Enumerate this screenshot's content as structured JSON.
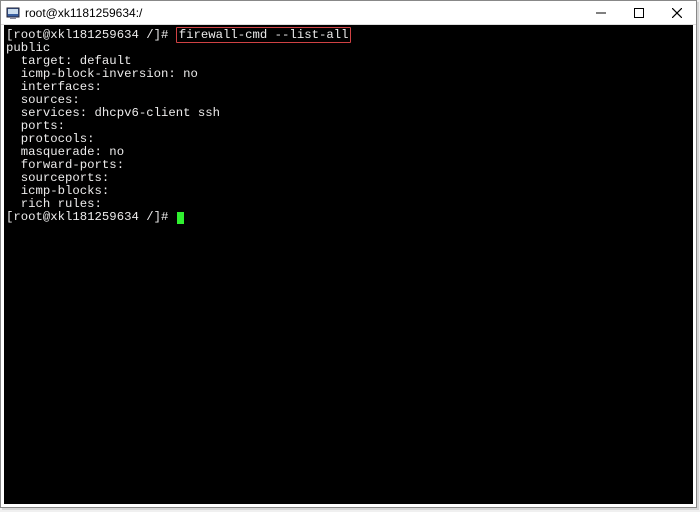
{
  "titlebar": {
    "title": "root@xk1181259634:/"
  },
  "terminal": {
    "prompt1_user": "[root@xkl181259634 /]#",
    "command1": "firewall-cmd --list-all",
    "output": {
      "l0": "public",
      "l1": "  target: default",
      "l2": "  icmp-block-inversion: no",
      "l3": "  interfaces:",
      "l4": "  sources:",
      "l5": "  services: dhcpv6-client ssh",
      "l6": "  ports:",
      "l7": "  protocols:",
      "l8": "  masquerade: no",
      "l9": "  forward-ports:",
      "l10": "  sourceports:",
      "l11": "  icmp-blocks:",
      "l12": "  rich rules:",
      "l13": ""
    },
    "prompt2_user": "[root@xkl181259634 /]#"
  }
}
